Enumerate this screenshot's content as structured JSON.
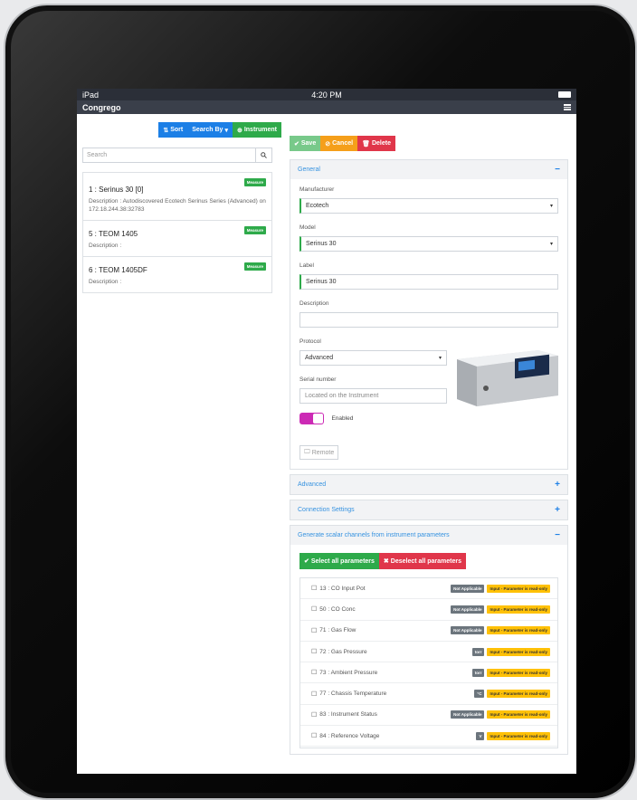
{
  "status": {
    "device": "iPad",
    "time": "4:20 PM"
  },
  "app": {
    "title": "Congrego"
  },
  "left": {
    "sort_label": "Sort",
    "search_by_label": "Search By",
    "instrument_label": "Instrument",
    "search_placeholder": "Search",
    "items": [
      {
        "name": "1 : Serinus 30 [0]",
        "description": "Description : Autodiscovered Ecotech Serinus Series (Advanced) on 172.18.244.38:32783",
        "badge": "Measure"
      },
      {
        "name": "5 : TEOM 1405",
        "description": "Description :",
        "badge": "Measure"
      },
      {
        "name": "6 : TEOM 1405DF",
        "description": "Description :",
        "badge": "Measure"
      }
    ]
  },
  "actions": {
    "save": "Save",
    "cancel": "Cancel",
    "delete": "Delete"
  },
  "general": {
    "header": "General",
    "toggle": "−",
    "manufacturer_label": "Manufacturer",
    "manufacturer": "Ecotech",
    "model_label": "Model",
    "model": "Serinus 30",
    "label_label": "Label",
    "label": "Serinus 30",
    "description_label": "Description",
    "description": "",
    "protocol_label": "Protocol",
    "protocol": "Advanced",
    "serial_label": "Serial number",
    "serial_placeholder": "Located on the Instrument",
    "enabled_label": "Enabled",
    "enabled": true,
    "remote_label": "Remote"
  },
  "advanced": {
    "header": "Advanced",
    "toggle": "+"
  },
  "connection": {
    "header": "Connection Settings",
    "toggle": "+"
  },
  "scalar": {
    "header": "Generate scalar channels from instrument parameters",
    "toggle": "−",
    "select_all": "Select all parameters",
    "deselect_all": "Deselect all parameters",
    "params": [
      {
        "label": "13 : CO Input Pot",
        "tag": "Not Applicable",
        "status": "Input - Parameter is read-only"
      },
      {
        "label": "50 : CO Conc",
        "tag": "Not Applicable",
        "status": "Input - Parameter is read-only"
      },
      {
        "label": "71 : Gas Flow",
        "tag": "Not Applicable",
        "status": "Input - Parameter is read-only"
      },
      {
        "label": "72 : Gas Pressure",
        "tag": "torr",
        "status": "Input - Parameter is read-only"
      },
      {
        "label": "73 : Ambient Pressure",
        "tag": "torr",
        "status": "Input - Parameter is read-only"
      },
      {
        "label": "77 : Chassis Temperature",
        "tag": "°C",
        "status": "Input - Parameter is read-only"
      },
      {
        "label": "83 : Instrument Status",
        "tag": "Not Applicable",
        "status": "Input - Parameter is read-only"
      },
      {
        "label": "84 : Reference Voltage",
        "tag": "V",
        "status": "Input - Parameter is read-only"
      }
    ]
  },
  "colors": {
    "primary": "#1c7fe6",
    "success": "#2eaa4a",
    "warning": "#f59f1a",
    "danger": "#e0364a",
    "toggle": "#cc2ab5"
  }
}
